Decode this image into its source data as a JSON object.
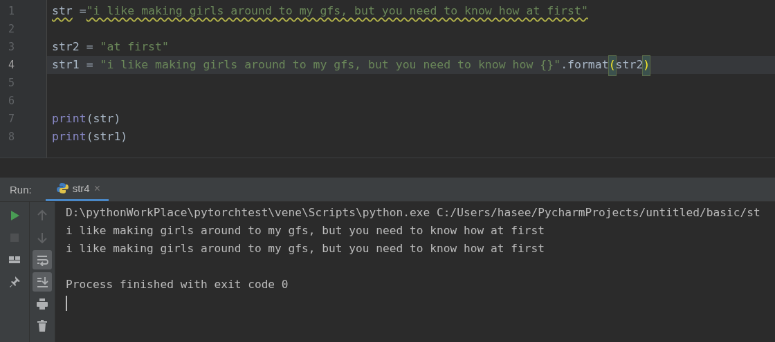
{
  "editor": {
    "lines": [
      {
        "number": "1",
        "current": false,
        "tokens": [
          {
            "kind": "plain",
            "text": "str",
            "warning": true
          },
          {
            "kind": "plain",
            "text": " =",
            "warning": false
          },
          {
            "kind": "string",
            "text": "\"i like making girls around to my gfs, but you need to know how at first\"",
            "warning": true
          }
        ]
      },
      {
        "number": "2",
        "current": false
      },
      {
        "number": "3",
        "current": false,
        "tokens": [
          {
            "kind": "plain",
            "text": "str2 = ",
            "warning": false
          },
          {
            "kind": "string",
            "text": "\"at first\"",
            "warning": false
          }
        ]
      },
      {
        "number": "4",
        "current": true,
        "tokens": [
          {
            "kind": "plain",
            "text": "str1 = ",
            "warning": false
          },
          {
            "kind": "string",
            "text": "\"i like making girls around to my gfs, but you need to know how {}\"",
            "warning": false
          },
          {
            "kind": "plain",
            "text": ".format",
            "warning": false
          },
          {
            "kind": "brace-match",
            "text": "(",
            "warning": false
          },
          {
            "kind": "plain",
            "text": "str2",
            "warning": false
          },
          {
            "kind": "brace-match",
            "text": ")",
            "warning": false
          }
        ]
      },
      {
        "number": "5",
        "current": false
      },
      {
        "number": "6",
        "current": false
      },
      {
        "number": "7",
        "current": false,
        "tokens": [
          {
            "kind": "builtin",
            "text": "print",
            "warning": false
          },
          {
            "kind": "plain",
            "text": "(str)",
            "warning": false
          }
        ]
      },
      {
        "number": "8",
        "current": false,
        "tokens": [
          {
            "kind": "builtin",
            "text": "print",
            "warning": false
          },
          {
            "kind": "plain",
            "text": "(str1)",
            "warning": false
          }
        ]
      }
    ]
  },
  "run_panel": {
    "label": "Run:",
    "tabs": [
      {
        "label": "str4",
        "selected": true,
        "close": "×"
      }
    ],
    "left_tools": [
      {
        "kind": "run",
        "disabled": false
      },
      {
        "kind": "stop",
        "disabled": true
      },
      {
        "kind": "layout",
        "disabled": false
      },
      {
        "kind": "pin",
        "disabled": false
      }
    ],
    "right_tools": [
      {
        "kind": "up",
        "on": false,
        "disabled": true
      },
      {
        "kind": "down",
        "on": false,
        "disabled": true
      },
      {
        "kind": "soft-wrap",
        "on": true,
        "disabled": false
      },
      {
        "kind": "scroll-end",
        "on": true,
        "disabled": false
      },
      {
        "kind": "print",
        "on": false,
        "disabled": false
      },
      {
        "kind": "trash",
        "on": false,
        "disabled": false
      }
    ],
    "console": [
      {
        "kind": "command",
        "text": "D:\\pythonWorkPlace\\pytorchtest\\vene\\Scripts\\python.exe C:/Users/hasee/PycharmProjects/untitled/basic/st"
      },
      {
        "kind": "stdout",
        "text": "i like making girls around to my gfs, but you need to know how at first"
      },
      {
        "kind": "stdout",
        "text": "i like making girls around to my gfs, but you need to know how at first"
      },
      {
        "kind": "exit",
        "text": "Process finished with exit code 0"
      }
    ]
  }
}
